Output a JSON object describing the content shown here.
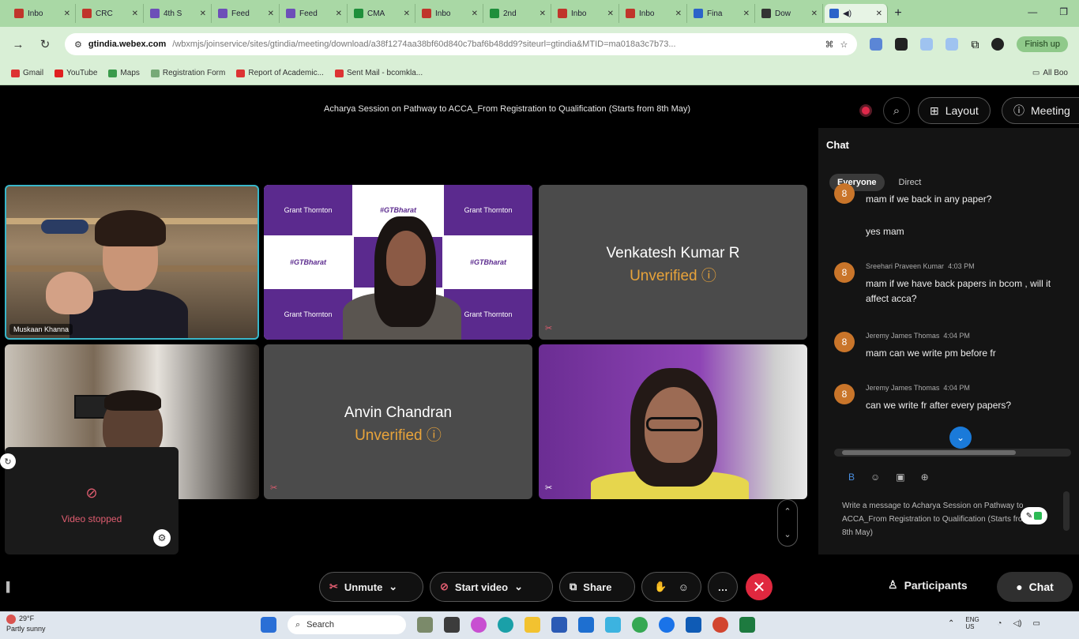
{
  "browser": {
    "tabs": [
      "Inbo",
      "CRC",
      "4th S",
      "Feed",
      "Feed",
      "CMA",
      "Inbo",
      "2nd",
      "Inbo",
      "Inbo",
      "Fina",
      "Dow",
      ""
    ],
    "new_tab": "+",
    "url_domain": "gtindia.webex.com",
    "url_path": "/wbxmjs/joinservice/sites/gtindia/meeting/download/a38f1274aa38bf60d840c7baf6b48dd9?siteurl=gtindia&MTID=ma018a3c7b73...",
    "finish_update": "Finish up",
    "bookmarks": [
      "Gmail",
      "YouTube",
      "Maps",
      "Registration Form",
      "Report of Academic...",
      "Sent Mail - bcomkla..."
    ],
    "all_bookmarks": "All Boo"
  },
  "meeting": {
    "title": "Acharya Session on Pathway to ACCA_From Registration to Qualification (Starts from 8th May)",
    "layout_label": "Layout",
    "meeting_label": "Meeting",
    "speaker_name": "Muskaan Khanna",
    "gt_brand": "Grant Thornton",
    "gt_tag": "#GTBharat",
    "participants": [
      {
        "name": "Venkatesh Kumar R",
        "status": "Unverified"
      },
      {
        "name": "Anvin Chandran",
        "status": "Unverified"
      }
    ],
    "video_stopped": "Video stopped"
  },
  "chat": {
    "title": "Chat",
    "tab_everyone": "Everyone",
    "tab_direct": "Direct",
    "messages": [
      {
        "sender": "",
        "time": "",
        "text": "mam if we back in any paper?"
      },
      {
        "sender": "",
        "time": "",
        "text": "yes mam"
      },
      {
        "sender": "Sreehari Praveen Kumar",
        "time": "4:03 PM",
        "text": "mam if we have back papers in bcom , will it affect acca?"
      },
      {
        "sender": "Jeremy James Thomas",
        "time": "4:04 PM",
        "text": "mam can we write pm before fr"
      },
      {
        "sender": "Jeremy James Thomas",
        "time": "4:04 PM",
        "text": "can we write fr after every papers?"
      }
    ],
    "compose_placeholder": "Write a message to Acharya Session on Pathway to ACCA_From Registration to Qualification (Starts from 8th May)"
  },
  "controls": {
    "unmute": "Unmute",
    "start_video": "Start video",
    "share": "Share",
    "participants": "Participants",
    "chat": "Chat"
  },
  "taskbar": {
    "temp": "29°F",
    "weather": "Partly sunny",
    "search": "Search",
    "lang": "ENG US"
  }
}
